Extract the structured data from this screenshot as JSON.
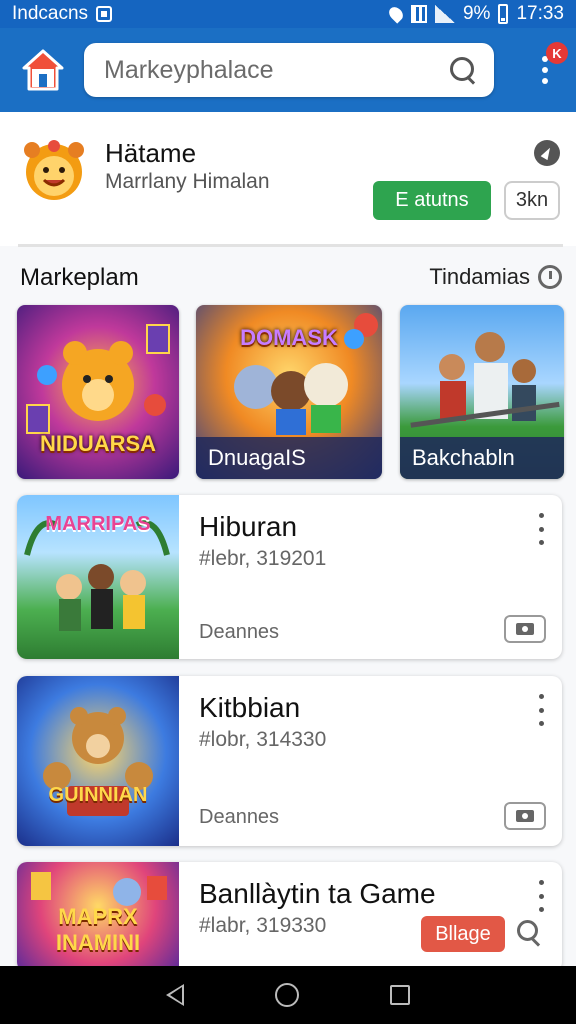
{
  "status_bar": {
    "carrier": "Indcacns",
    "battery": "9%",
    "time": "17:33",
    "icons": [
      "sim-icon",
      "location-icon",
      "grid-icon",
      "signal-icon",
      "battery-icon"
    ]
  },
  "app_bar": {
    "search_placeholder": "Markeyphalace",
    "notification_badge": "K",
    "icons": [
      "home-icon",
      "search-icon",
      "overflow-menu-icon"
    ],
    "colors": {
      "primary": "#1b6fc4",
      "status": "#1565c0"
    }
  },
  "profile": {
    "name": "Hätame",
    "subtitle": "Marrlany Himalan",
    "primary_button": "E atutns",
    "secondary_button": "3kn",
    "colors": {
      "green": "#2ea44f"
    }
  },
  "section": {
    "title": "Markeplam",
    "right_label": "Tindamias"
  },
  "featured": [
    {
      "title_art": "NIDUARSA",
      "caption": ""
    },
    {
      "title_art": "DOMASK",
      "caption": "DnuagaIS"
    },
    {
      "title_art": "",
      "caption": "Bakchabln"
    }
  ],
  "list": [
    {
      "title": "Hiburan",
      "subtitle": "#lebr, 319201",
      "footer": "Deannes",
      "thumb_text": "MARRIPAS"
    },
    {
      "title": "Kitbbian",
      "subtitle": "#lobr, 314330",
      "footer": "Deannes",
      "thumb_text": "GUINNIAN"
    },
    {
      "title": "Banllàytin ta Game",
      "subtitle": "#labr, 319330",
      "action_button": "Bllage",
      "thumb_text": "MAPRX INAMINI",
      "colors": {
        "red": "#e25846"
      }
    }
  ],
  "nav": {
    "icons": [
      "back-icon",
      "home-circle-icon",
      "recents-icon"
    ]
  }
}
